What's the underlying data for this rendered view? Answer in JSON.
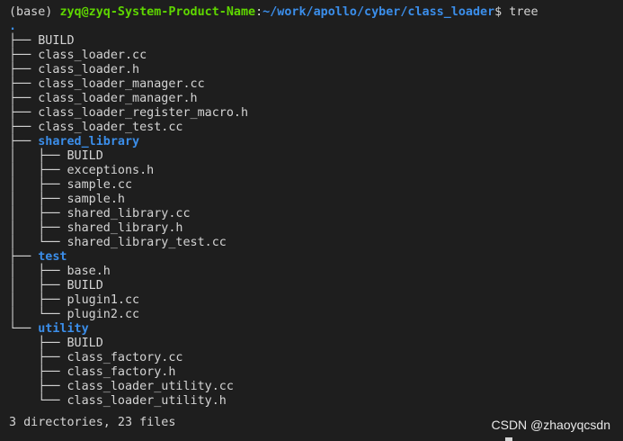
{
  "prompt": {
    "env": "(base) ",
    "user_host": "zyq@zyq-System-Product-Name",
    "colon": ":",
    "path": "~/work/apollo/cyber/class_loader",
    "symbol": "$ ",
    "command": "tree"
  },
  "tree": {
    "root": ".",
    "entries": [
      {
        "prefix": "├── ",
        "name": "BUILD",
        "type": "file"
      },
      {
        "prefix": "├── ",
        "name": "class_loader.cc",
        "type": "file"
      },
      {
        "prefix": "├── ",
        "name": "class_loader.h",
        "type": "file"
      },
      {
        "prefix": "├── ",
        "name": "class_loader_manager.cc",
        "type": "file"
      },
      {
        "prefix": "├── ",
        "name": "class_loader_manager.h",
        "type": "file"
      },
      {
        "prefix": "├── ",
        "name": "class_loader_register_macro.h",
        "type": "file"
      },
      {
        "prefix": "├── ",
        "name": "class_loader_test.cc",
        "type": "file"
      },
      {
        "prefix": "├── ",
        "name": "shared_library",
        "type": "dir"
      },
      {
        "prefix": "│   ├── ",
        "name": "BUILD",
        "type": "file"
      },
      {
        "prefix": "│   ├── ",
        "name": "exceptions.h",
        "type": "file"
      },
      {
        "prefix": "│   ├── ",
        "name": "sample.cc",
        "type": "file"
      },
      {
        "prefix": "│   ├── ",
        "name": "sample.h",
        "type": "file"
      },
      {
        "prefix": "│   ├── ",
        "name": "shared_library.cc",
        "type": "file"
      },
      {
        "prefix": "│   ├── ",
        "name": "shared_library.h",
        "type": "file"
      },
      {
        "prefix": "│   └── ",
        "name": "shared_library_test.cc",
        "type": "file"
      },
      {
        "prefix": "├── ",
        "name": "test",
        "type": "dir"
      },
      {
        "prefix": "│   ├── ",
        "name": "base.h",
        "type": "file"
      },
      {
        "prefix": "│   ├── ",
        "name": "BUILD",
        "type": "file"
      },
      {
        "prefix": "│   ├── ",
        "name": "plugin1.cc",
        "type": "file"
      },
      {
        "prefix": "│   └── ",
        "name": "plugin2.cc",
        "type": "file"
      },
      {
        "prefix": "└── ",
        "name": "utility",
        "type": "dir"
      },
      {
        "prefix": "    ├── ",
        "name": "BUILD",
        "type": "file"
      },
      {
        "prefix": "    ├── ",
        "name": "class_factory.cc",
        "type": "file"
      },
      {
        "prefix": "    ├── ",
        "name": "class_factory.h",
        "type": "file"
      },
      {
        "prefix": "    ├── ",
        "name": "class_loader_utility.cc",
        "type": "file"
      },
      {
        "prefix": "    └── ",
        "name": "class_loader_utility.h",
        "type": "file"
      }
    ]
  },
  "summary": "3 directories, 23 files",
  "watermark": "CSDN @zhaoyqcsdn",
  "colors": {
    "background": "#1e1e1e",
    "text": "#d4d4d4",
    "user_host": "#5fd700",
    "path": "#3b8eea",
    "directory": "#3b8eea"
  }
}
